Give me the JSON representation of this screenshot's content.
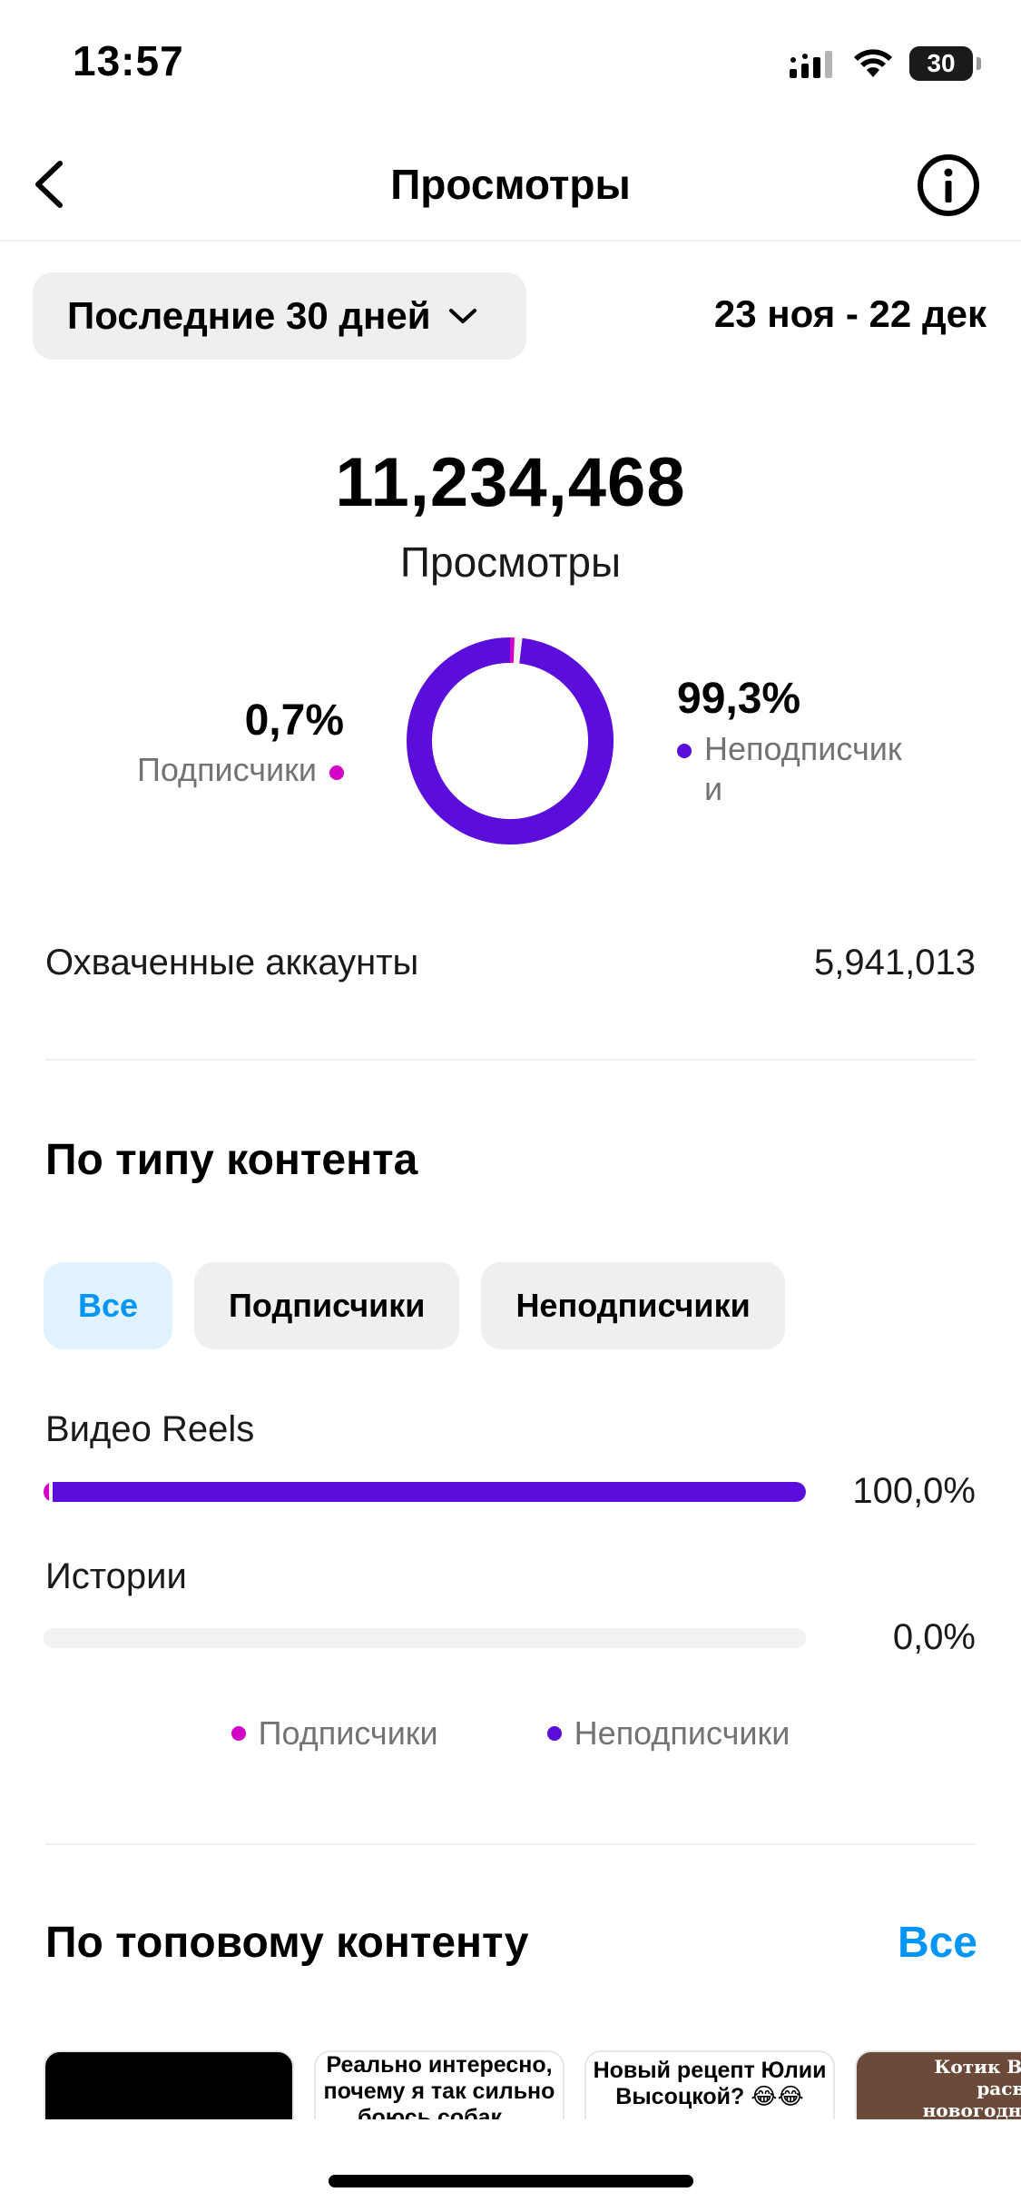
{
  "status_bar": {
    "time": "13:57",
    "battery": "30"
  },
  "nav": {
    "title": "Просмотры"
  },
  "period": {
    "label": "Последние 30 дней",
    "date_range": "23 ноя - 22 дек"
  },
  "summary": {
    "total_value": "11,234,468",
    "total_label": "Просмотры",
    "followers_pct": "0,7%",
    "followers_label": "Подписчики",
    "non_followers_pct": "99,3%",
    "non_followers_label": "Неподписчик и",
    "followers_share": 0.7,
    "non_followers_share": 99.3
  },
  "reach": {
    "label": "Охваченные аккаунты",
    "value": "5,941,013"
  },
  "content_type": {
    "title": "По типу контента",
    "chips": [
      "Все",
      "Подписчики",
      "Неподписчики"
    ],
    "bars": [
      {
        "label": "Видео Reels",
        "pct_text": "100,0%",
        "followers_share": 0.7,
        "non_followers_share": 99.3
      },
      {
        "label": "Истории",
        "pct_text": "0,0%",
        "followers_share": 0,
        "non_followers_share": 0
      }
    ],
    "legend": [
      "Подписчики",
      "Неподписчики"
    ]
  },
  "top_content": {
    "title": "По топовому контенту",
    "see_all": "Все",
    "thumbs": [
      {
        "text": ""
      },
      {
        "text": "Реально интересно, почему я так сильно боюсь собак..."
      },
      {
        "text": "Новый рецепт Юлии Высоцкой? 😂😂"
      },
      {
        "text": "Котик Василий расвеселил новогоднее наст своими джингл бел"
      }
    ]
  },
  "colors": {
    "followers": "#d300c5",
    "non_followers": "#5b0ddb",
    "accent": "#0095f6"
  }
}
